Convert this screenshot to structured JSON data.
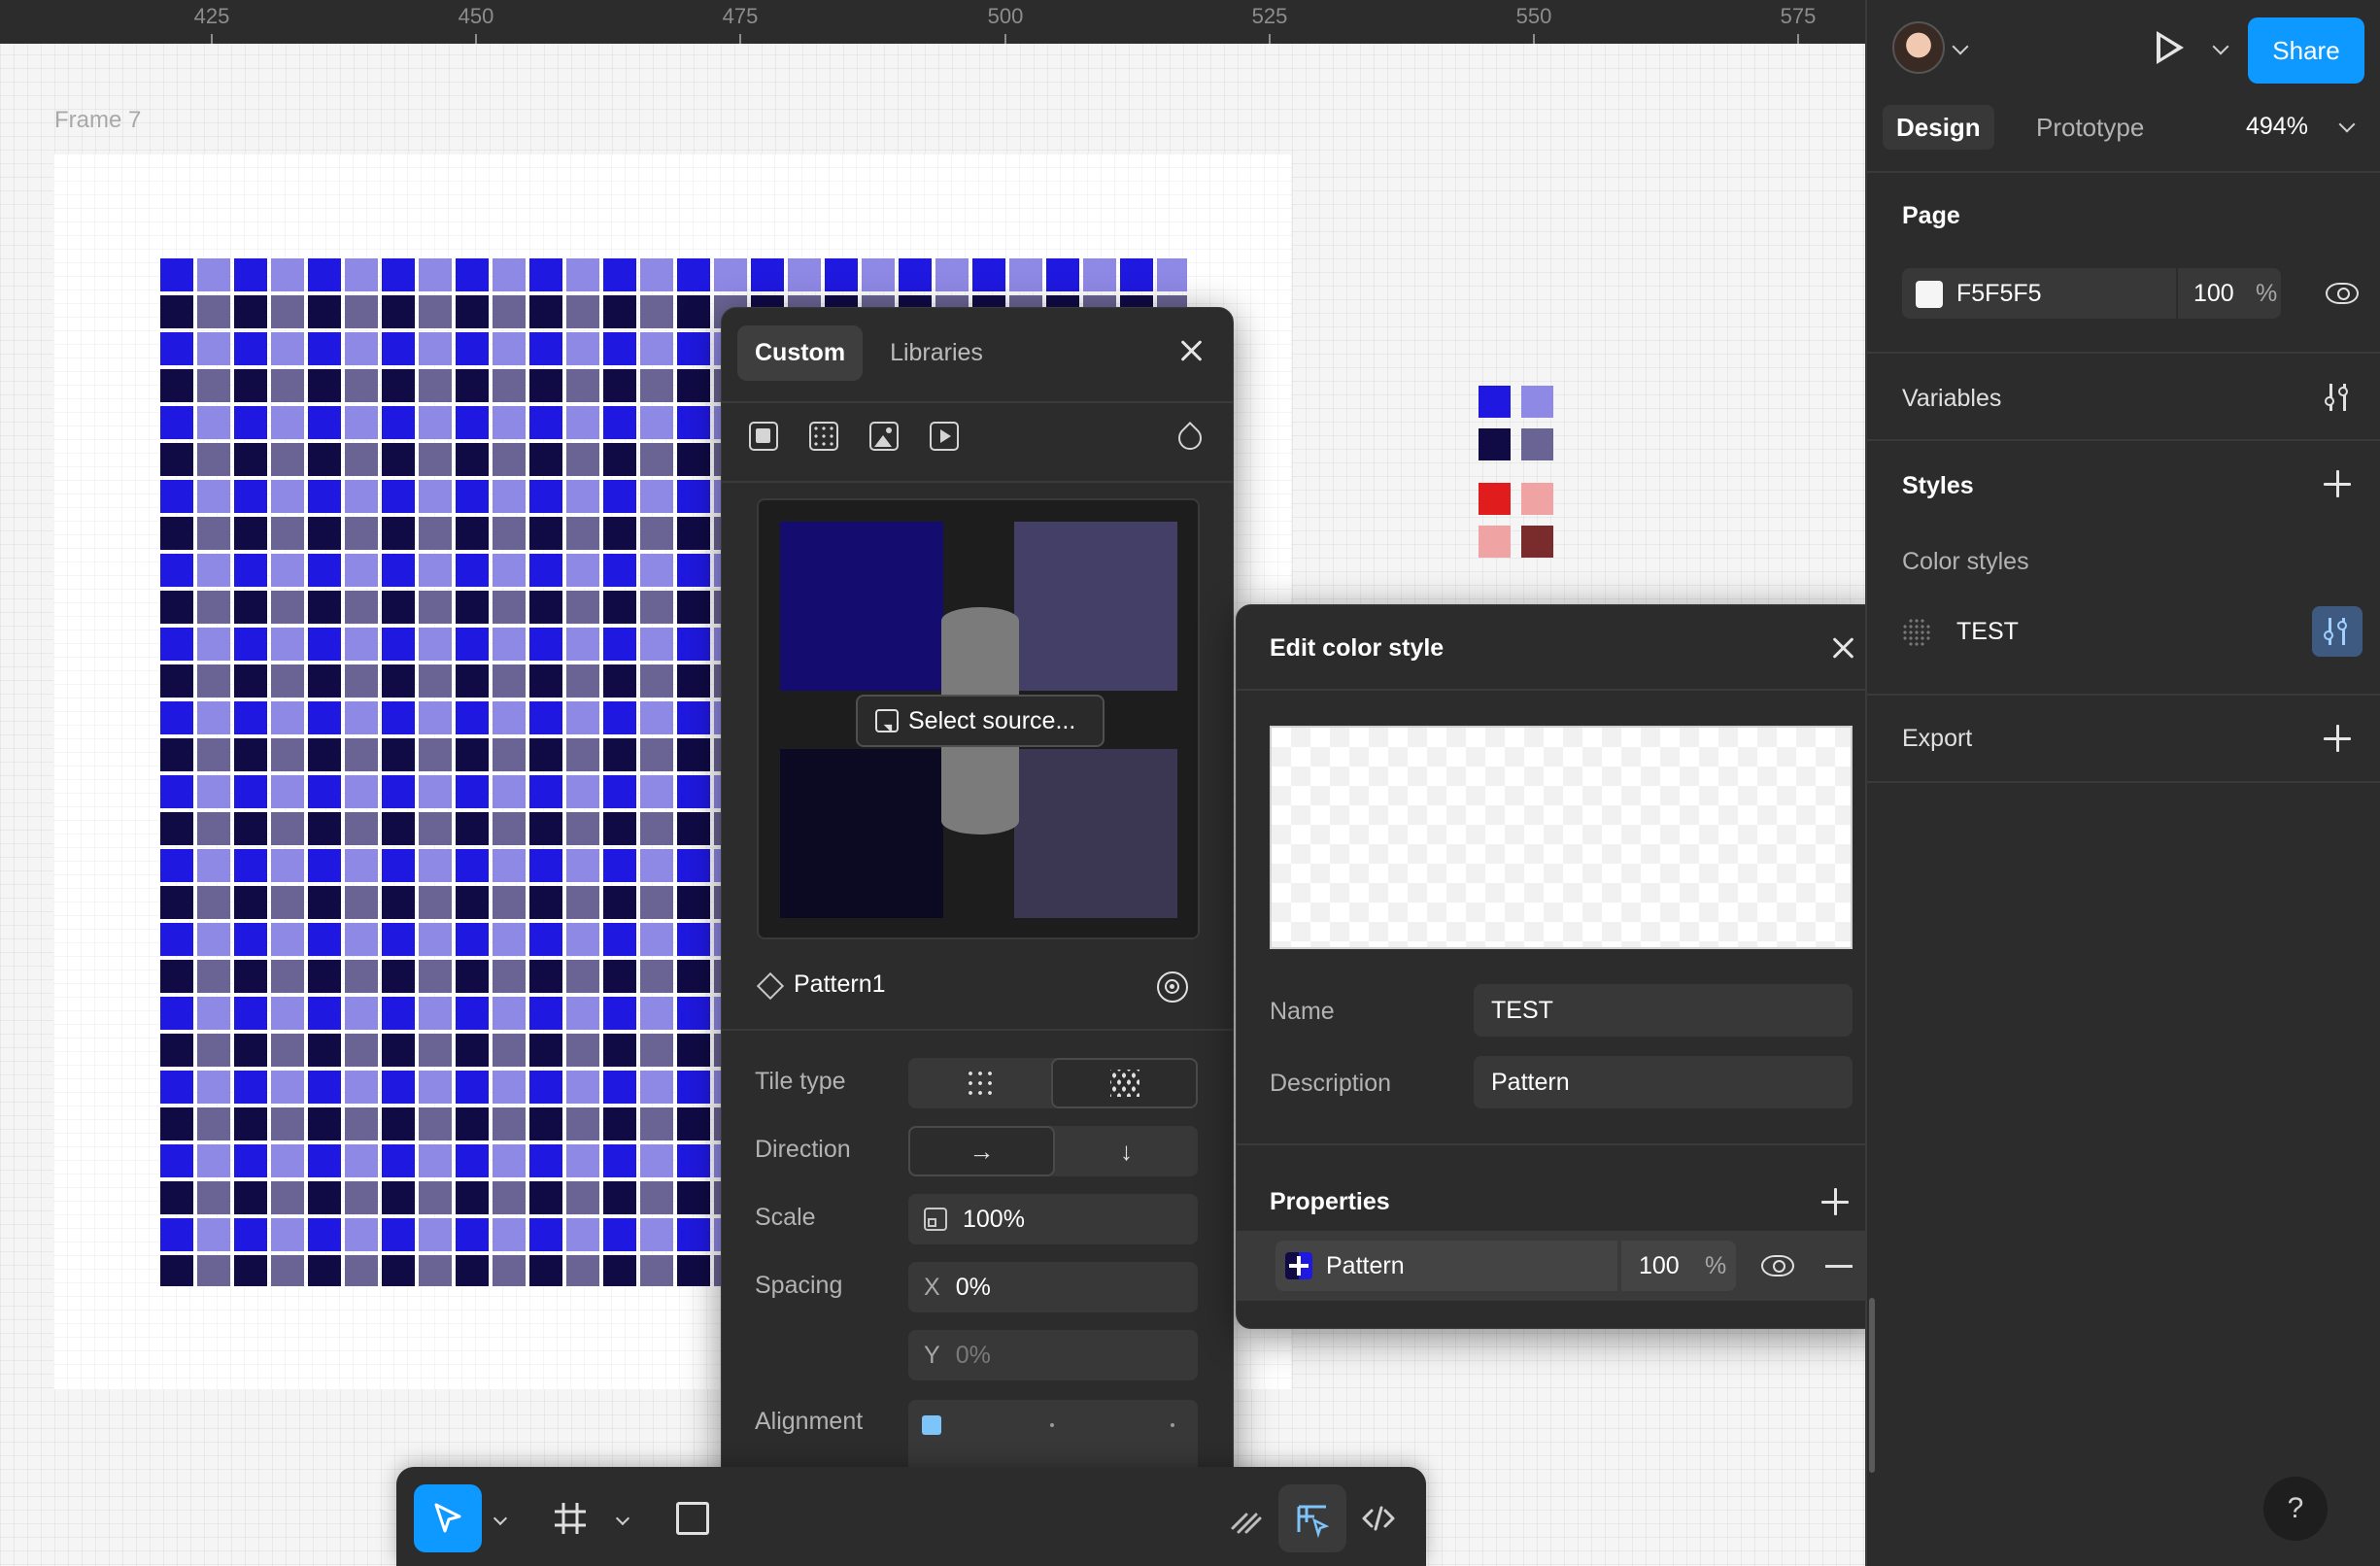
{
  "canvas": {
    "ruler_ticks": [
      "425",
      "450",
      "475",
      "500",
      "525",
      "550",
      "575"
    ],
    "frame_label": "Frame 7",
    "pattern_colors": [
      "#1f18e0",
      "#8f89e6",
      "#100b45",
      "#6a6494"
    ],
    "swatch_colors": [
      "#1f18e0",
      "#8f89e6",
      "#100b45",
      "#6a6494",
      "#e01c1c",
      "#f0a3a3",
      "#f0a3a3",
      "#7a2c2c"
    ]
  },
  "fill_picker": {
    "tabs": [
      "Custom",
      "Libraries"
    ],
    "active_tab": "Custom",
    "fill_type_icons": [
      "solid-fill-icon",
      "pattern-fill-icon",
      "image-fill-icon",
      "video-fill-icon",
      "blend-drop-icon"
    ],
    "preview_colors": [
      "#140c6e",
      "#433f66",
      "#0c0a22",
      "#3b3752"
    ],
    "select_source_label": "Select source...",
    "pattern_name": "Pattern1",
    "tile_type_label": "Tile type",
    "direction_label": "Direction",
    "direction_right": "→",
    "direction_down": "↓",
    "scale_label": "Scale",
    "scale_value": "100%",
    "spacing_label": "Spacing",
    "spacing_x_prefix": "X",
    "spacing_x_value": "0%",
    "spacing_y_prefix": "Y",
    "spacing_y_value": "0%",
    "alignment_label": "Alignment"
  },
  "edit_style": {
    "title": "Edit color style",
    "name_label": "Name",
    "name_value": "TEST",
    "description_label": "Description",
    "description_value": "Pattern",
    "properties_title": "Properties",
    "property_name": "Pattern",
    "property_opacity": "100",
    "property_pct": "%"
  },
  "sidebar": {
    "share_label": "Share",
    "tabs": [
      "Design",
      "Prototype"
    ],
    "zoom": "494%",
    "page_title": "Page",
    "page_hex": "F5F5F5",
    "page_opacity": "100",
    "page_pct": "%",
    "variables_title": "Variables",
    "styles_title": "Styles",
    "color_styles_label": "Color styles",
    "style_item": "TEST",
    "export_title": "Export",
    "help": "?"
  },
  "colors": {
    "accent": "#0d99ff",
    "panel": "#2c2c2c",
    "field": "#383838"
  }
}
